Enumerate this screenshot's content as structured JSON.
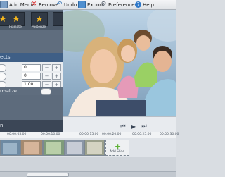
{
  "toolbar": {
    "add_media": "Add Media",
    "remove": "Remove",
    "undo": "Undo",
    "export": "Export",
    "preferences": "Preferences",
    "help": "Help"
  },
  "effects_panel": {
    "thumb_labels": [
      "Pixelate",
      "Posterize"
    ],
    "header": "ects",
    "values": [
      "0",
      "0",
      "1.00"
    ],
    "normalize_label": "rmalize"
  },
  "bottom_tab": "n",
  "timeline": {
    "ticks": [
      "00:00:05.00",
      "00:00:10.00",
      "00:00:15.00",
      "00:00:20.00",
      "00:00:25.00",
      "00:00:30.00"
    ],
    "add_slide_label": "Add Slide"
  },
  "colors": {
    "accent_blue": "#3f5f86",
    "panel_gray": "#5f6d7e",
    "add_green": "#6fbf3c"
  }
}
